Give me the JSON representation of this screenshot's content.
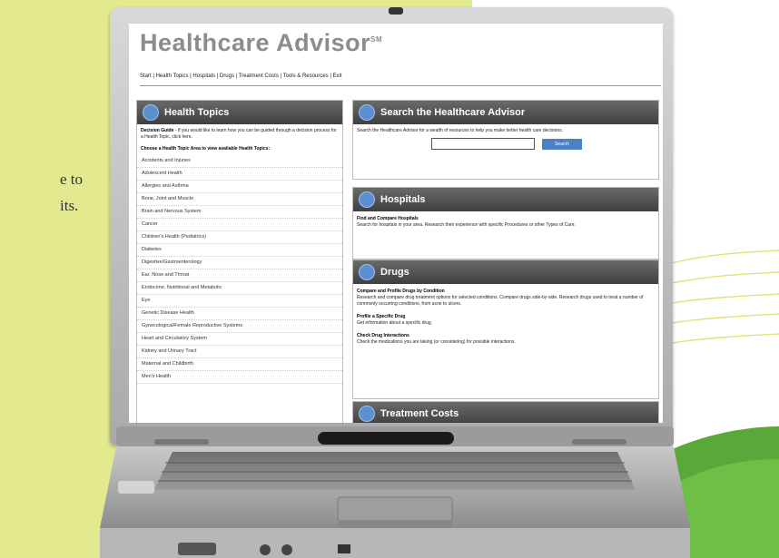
{
  "left_text": {
    "line1": "e to",
    "line2": "its."
  },
  "app": {
    "title": "Healthcare Advisor",
    "trademark": "SM",
    "nav": "Start | Health Topics | Hospitals | Drugs | Treatment Costs | Tools & Resources | Exit"
  },
  "health_topics": {
    "header": "Health Topics",
    "decision_link": "Decision Guide",
    "decision_text": " - If you would like to learn how you can be guided through a decision process for a Health Topic, click here.",
    "prompt": "Choose a Health Topic Area to view available Health Topics:",
    "items": [
      "Accidents and Injuries",
      "Adolescent Health",
      "Allergies and Asthma",
      "Bone, Joint and Muscle",
      "Brain and Nervous System",
      "Cancer",
      "Children's Health (Pediatrics)",
      "Diabetes",
      "Digestive/Gastroenterology",
      "Ear, Nose and Throat",
      "Endocrine, Nutritional and Metabolic",
      "Eye",
      "Genetic Disease Health",
      "Gynecological/Female Reproductive Systems",
      "Heart and Circulatory System",
      "Kidney and Urinary Tract",
      "Maternal and Childbirth",
      "Men's Health"
    ]
  },
  "search": {
    "header": "Search the Healthcare Advisor",
    "text": "Search the Healthcare Advisor for a wealth of resources to help you make better health care decisions.",
    "button": "Search"
  },
  "hospitals": {
    "header": "Hospitals",
    "link": "Find and Compare Hospitals",
    "text": "Search for hospitals in your area. Research their experience with specific Procedures or other Types of Care."
  },
  "drugs": {
    "header": "Drugs",
    "link1": "Compare and Profile Drugs by Condition",
    "text1": "Research and compare drug treatment options for selected conditions. Compare drugs side-by-side. Research drugs used to treat a number of commonly occurring conditions, from acne to ulcers.",
    "link2": "Profile a Specific Drug",
    "text2": "Get information about a specific drug.",
    "link3": "Check Drug Interactions",
    "text3": "Check the medications you are taking (or considering) for possible interactions."
  },
  "treatment_costs": {
    "header": "Treatment Costs"
  },
  "colors": {
    "background_left": "#e3e98f",
    "panel_header": "#4a4a4a",
    "accent_blue": "#4b80c5"
  }
}
